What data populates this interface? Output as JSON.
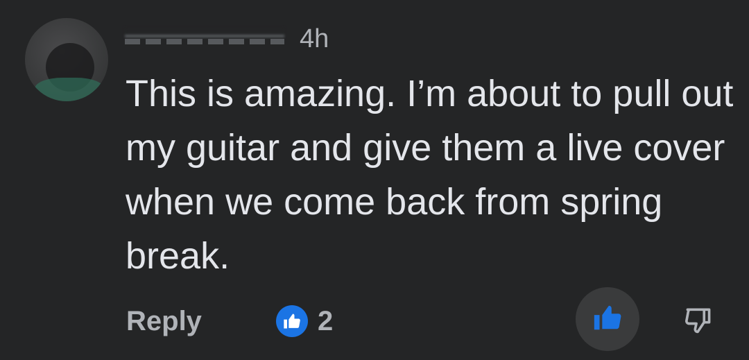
{
  "comment": {
    "timestamp": "4h",
    "text": "This is amazing. I’m about to pull out my guitar and give them a live cover when we come back from spring break.",
    "reply_label": "Reply",
    "like_count": "2"
  },
  "icons": {
    "like_badge": "thumbs-up-icon",
    "like_button": "thumbs-up-icon",
    "dislike_button": "thumbs-down-icon"
  },
  "colors": {
    "background": "#242526",
    "text": "#e4e6eb",
    "secondary_text": "#b0b3b8",
    "accent": "#1b74e4",
    "button_bg": "#3a3b3c"
  }
}
